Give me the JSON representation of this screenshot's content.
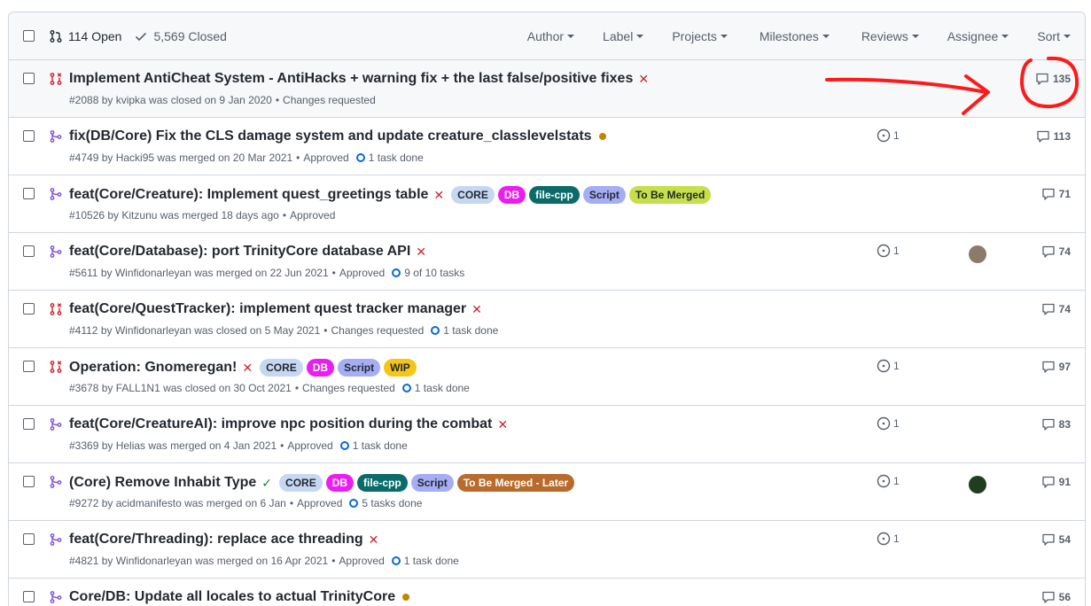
{
  "header": {
    "open_label": "114 Open",
    "closed_label": "5,569 Closed",
    "filters": [
      "Author",
      "Label",
      "Projects",
      "Milestones",
      "Reviews",
      "Assignee",
      "Sort"
    ]
  },
  "colors": {
    "closed_pr": "#cf222e",
    "merged_pr": "#8250df",
    "pending": "#bf8700",
    "success": "#1a7f37"
  },
  "rows": [
    {
      "state": "closed",
      "title": "Implement AntiCheat System - AntiHacks + warning fix + the last false/positive fixes",
      "status": "x",
      "labels": [],
      "meta": "#2088 by kvipka was closed on 9 Jan 2020",
      "review": "Changes requested",
      "tasks": "",
      "linked": "",
      "assignee": "",
      "comments": "135",
      "highlight": true
    },
    {
      "state": "merged",
      "title": "fix(DB/Core) Fix the CLS damage system and update creature_classlevelstats",
      "status": "dot",
      "labels": [],
      "meta": "#4749 by Hacki95 was merged on 20 Mar 2021",
      "review": "Approved",
      "tasks": "1 task done",
      "linked": "1",
      "assignee": "",
      "comments": "113"
    },
    {
      "state": "merged",
      "title": "feat(Core/Creature): Implement quest_greetings table",
      "status": "x",
      "labels": [
        {
          "text": "CORE",
          "bg": "#c5d7f2",
          "fg": "#24292f"
        },
        {
          "text": "DB",
          "bg": "#e91ef0",
          "fg": "#ffffff"
        },
        {
          "text": "file-cpp",
          "bg": "#0b6b6b",
          "fg": "#ffffff"
        },
        {
          "text": "Script",
          "bg": "#a5aef5",
          "fg": "#24292f"
        },
        {
          "text": "To Be Merged",
          "bg": "#c5e04a",
          "fg": "#24292f"
        }
      ],
      "meta": "#10526 by Kitzunu was merged 18 days ago",
      "review": "Approved",
      "tasks": "",
      "linked": "",
      "assignee": "",
      "comments": "71"
    },
    {
      "state": "merged",
      "title": "feat(Core/Database): port TrinityCore database API",
      "status": "x",
      "labels": [],
      "meta": "#5611 by Winfidonarleyan was merged on 22 Jun 2021",
      "review": "Approved",
      "tasks": "9 of 10 tasks",
      "linked": "1",
      "assignee": "#8c7a6b",
      "comments": "74"
    },
    {
      "state": "closed",
      "title": "feat(Core/QuestTracker): implement quest tracker manager",
      "status": "x",
      "labels": [],
      "meta": "#4112 by Winfidonarleyan was closed on 5 May 2021",
      "review": "Changes requested",
      "tasks": "1 task done",
      "linked": "",
      "assignee": "",
      "comments": "74"
    },
    {
      "state": "closed",
      "title": "Operation: Gnomeregan!",
      "status": "x",
      "labels": [
        {
          "text": "CORE",
          "bg": "#c5d7f2",
          "fg": "#24292f"
        },
        {
          "text": "DB",
          "bg": "#e91ef0",
          "fg": "#ffffff"
        },
        {
          "text": "Script",
          "bg": "#a5aef5",
          "fg": "#24292f"
        },
        {
          "text": "WIP",
          "bg": "#f5c518",
          "fg": "#24292f"
        }
      ],
      "meta": "#3678 by FALL1N1 was closed on 30 Oct 2021",
      "review": "Changes requested",
      "tasks": "1 task done",
      "linked": "1",
      "assignee": "",
      "comments": "97"
    },
    {
      "state": "merged",
      "title": "feat(Core/CreatureAI): improve npc position during the combat",
      "status": "x",
      "labels": [],
      "meta": "#3369 by Helias was merged on 4 Jan 2021",
      "review": "Approved",
      "tasks": "1 task done",
      "linked": "1",
      "assignee": "",
      "comments": "83"
    },
    {
      "state": "merged",
      "title": "(Core) Remove Inhabit Type",
      "status": "check",
      "labels": [
        {
          "text": "CORE",
          "bg": "#c5d7f2",
          "fg": "#24292f"
        },
        {
          "text": "DB",
          "bg": "#e91ef0",
          "fg": "#ffffff"
        },
        {
          "text": "file-cpp",
          "bg": "#0b6b6b",
          "fg": "#ffffff"
        },
        {
          "text": "Script",
          "bg": "#a5aef5",
          "fg": "#24292f"
        },
        {
          "text": "To Be Merged - Later",
          "bg": "#b86b2a",
          "fg": "#ffffff"
        }
      ],
      "meta": "#9272 by acidmanifesto was merged on 6 Jan",
      "review": "Approved",
      "tasks": "5 tasks done",
      "linked": "1",
      "assignee": "#1f3d1f",
      "comments": "91"
    },
    {
      "state": "merged",
      "title": "feat(Core/Threading): replace ace threading",
      "status": "x",
      "labels": [],
      "meta": "#4821 by Winfidonarleyan was merged on 16 Apr 2021",
      "review": "Approved",
      "tasks": "1 task done",
      "linked": "1",
      "assignee": "",
      "comments": "54"
    },
    {
      "state": "merged",
      "title": "Core/DB: Update all locales to actual TrinityCore",
      "status": "dot",
      "labels": [],
      "meta": "",
      "review": "",
      "tasks": "",
      "linked": "",
      "assignee": "",
      "comments": "56"
    }
  ]
}
